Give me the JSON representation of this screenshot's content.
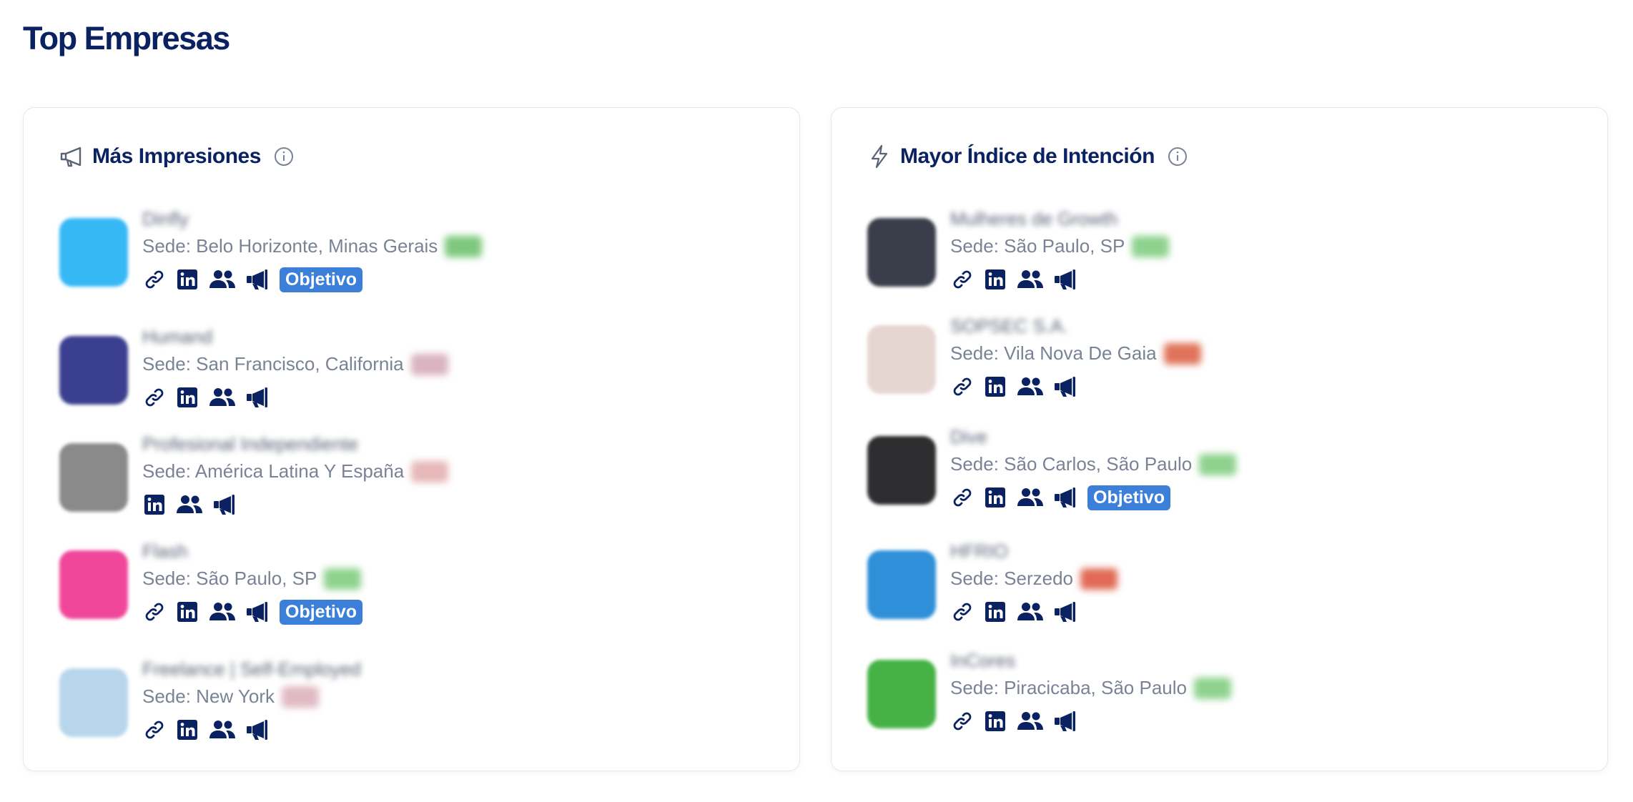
{
  "page": {
    "title": "Top Empresas"
  },
  "cards": [
    {
      "title": "Más Impresiones",
      "icon": "megaphone-outline-icon",
      "companies": [
        {
          "name": "Dinfly",
          "sede": "Sede: Belo Horizonte, Minas Gerais",
          "flag_color": "#7ec87e",
          "logo_color": "#36b8f5",
          "has_link": true,
          "has_linkedin": true,
          "has_people": true,
          "has_megaphone": true,
          "badge": "Objetivo"
        },
        {
          "name": "Humand",
          "sede": "Sede: San Francisco, California",
          "flag_color": "#d9b3c0",
          "logo_color": "#3a3f8f",
          "has_link": true,
          "has_linkedin": true,
          "has_people": true,
          "has_megaphone": true,
          "badge": ""
        },
        {
          "name": "Profesional Independiente",
          "sede": "Sede: América Latina Y España",
          "flag_color": "#e7b8b8",
          "logo_color": "#8a8a8a",
          "has_link": false,
          "has_linkedin": true,
          "has_people": true,
          "has_megaphone": true,
          "badge": ""
        },
        {
          "name": "Flash",
          "sede": "Sede: São Paulo, SP",
          "flag_color": "#8ed28e",
          "logo_color": "#f0479a",
          "has_link": true,
          "has_linkedin": true,
          "has_people": true,
          "has_megaphone": true,
          "badge": "Objetivo"
        },
        {
          "name": "Freelance | Self-Employed",
          "sede": "Sede: New York",
          "flag_color": "#e0b9c4",
          "logo_color": "#b7d6ec",
          "has_link": true,
          "has_linkedin": true,
          "has_people": true,
          "has_megaphone": true,
          "badge": ""
        }
      ]
    },
    {
      "title": "Mayor Índice de Intención",
      "icon": "lightning-icon",
      "companies": [
        {
          "name": "Mulheres de Growth",
          "sede": "Sede: São Paulo, SP",
          "flag_color": "#8ed28e",
          "logo_color": "#3a3d4a",
          "has_link": true,
          "has_linkedin": true,
          "has_people": true,
          "has_megaphone": true,
          "badge": ""
        },
        {
          "name": "SOPSEC S.A.",
          "sede": "Sede: Vila Nova De Gaia",
          "flag_color": "#e0735a",
          "logo_color": "#e6d6d2",
          "has_link": true,
          "has_linkedin": true,
          "has_people": true,
          "has_megaphone": true,
          "badge": ""
        },
        {
          "name": "Dive",
          "sede": "Sede: São Carlos, São Paulo",
          "flag_color": "#8ed28e",
          "logo_color": "#2e2e30",
          "has_link": true,
          "has_linkedin": true,
          "has_people": true,
          "has_megaphone": true,
          "badge": "Objetivo"
        },
        {
          "name": "HFRIO",
          "sede": "Sede: Serzedo",
          "flag_color": "#e06a55",
          "logo_color": "#2f8fd8",
          "has_link": true,
          "has_linkedin": true,
          "has_people": true,
          "has_megaphone": true,
          "badge": ""
        },
        {
          "name": "InCores",
          "sede": "Sede: Piracicaba, São Paulo",
          "flag_color": "#8ed28e",
          "logo_color": "#46b246",
          "has_link": true,
          "has_linkedin": true,
          "has_people": true,
          "has_megaphone": true,
          "badge": ""
        }
      ]
    }
  ]
}
